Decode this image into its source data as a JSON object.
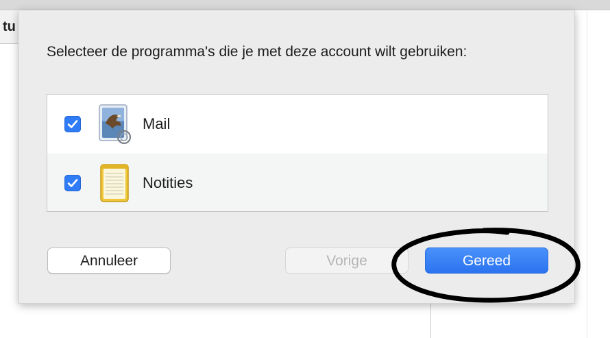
{
  "background": {
    "left_fragment_text": "tu"
  },
  "dialog": {
    "prompt": "Selecteer de programma's die je met deze account wilt gebruiken:",
    "apps": [
      {
        "label": "Mail",
        "checked": true,
        "icon": "mail-icon"
      },
      {
        "label": "Notities",
        "checked": true,
        "icon": "notes-icon"
      }
    ],
    "buttons": {
      "cancel": "Annuleer",
      "back": "Vorige",
      "done": "Gereed"
    }
  },
  "colors": {
    "accent": "#2f7cf6",
    "done_button": "#3a82f7",
    "annotation": "#000000"
  }
}
